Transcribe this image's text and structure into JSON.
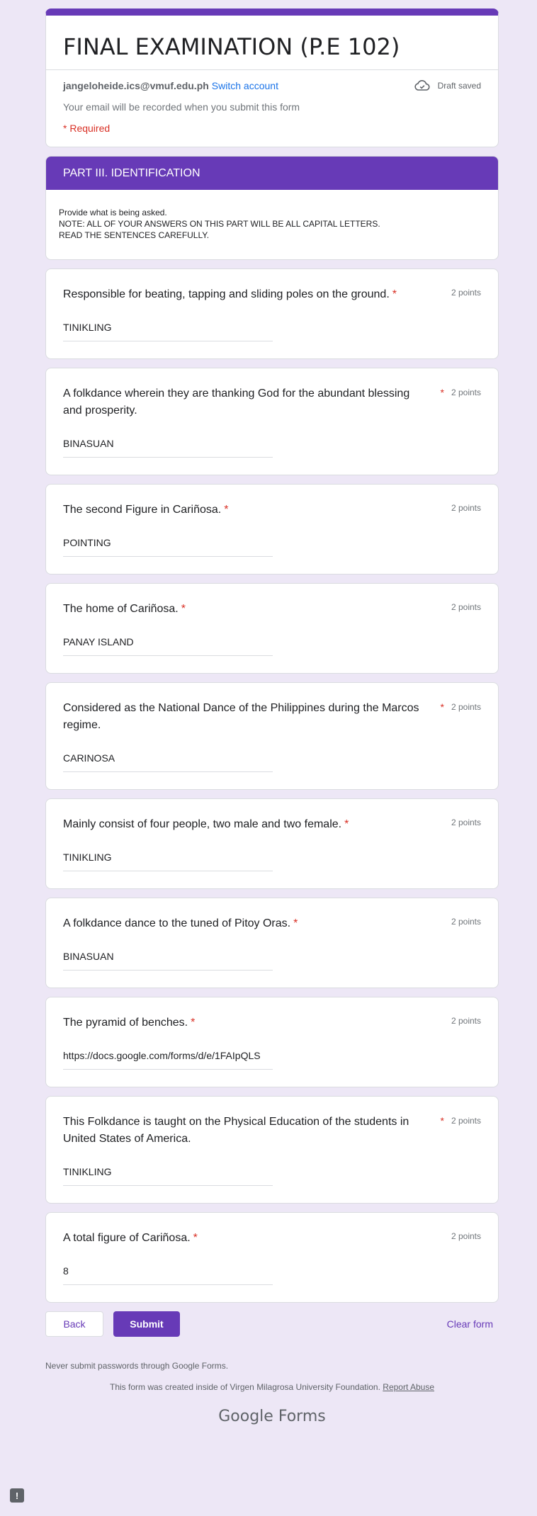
{
  "header": {
    "form_title": "FINAL EXAMINATION (P.E 102)",
    "email": "jangeloheide.ics@vmuf.edu.ph",
    "switch_account": "Switch account",
    "draft_status": "Draft saved",
    "email_note": "Your email will be recorded when you submit this form",
    "required_note": "* Required"
  },
  "section": {
    "title": "PART III. IDENTIFICATION",
    "description": "Provide what is being asked.\nNOTE: ALL OF YOUR ANSWERS ON THIS PART WILL BE ALL CAPITAL LETTERS.\nREAD THE SENTENCES CAREFULLY."
  },
  "questions": [
    {
      "title": "Responsible for beating, tapping and sliding poles on the ground.",
      "points": "2 points",
      "answer": "TINIKLING"
    },
    {
      "title": "A folkdance wherein they are thanking God for the abundant blessing and prosperity.",
      "points": "2 points",
      "answer": "BINASUAN"
    },
    {
      "title": "The second Figure in Cariñosa.",
      "points": "2 points",
      "answer": "POINTING"
    },
    {
      "title": "The home of Cariñosa.",
      "points": "2 points",
      "answer": "PANAY ISLAND"
    },
    {
      "title": "Considered as the National Dance of the Philippines during the Marcos regime.",
      "points": "2 points",
      "answer": "CARINOSA"
    },
    {
      "title": "Mainly consist of four people, two male and two female.",
      "points": "2 points",
      "answer": "TINIKLING"
    },
    {
      "title": "A folkdance dance to the tuned of Pitoy Oras.",
      "points": "2 points",
      "answer": "BINASUAN"
    },
    {
      "title": "The pyramid of benches.",
      "points": "2 points",
      "answer": "https://docs.google.com/forms/d/e/1FAIpQLS"
    },
    {
      "title": "This Folkdance is taught on the Physical Education of the students in United States of America.",
      "points": "2 points",
      "answer": "TINIKLING"
    },
    {
      "title": "A total figure of Cariñosa.",
      "points": "2 points",
      "answer": "8"
    }
  ],
  "required_mark": "*",
  "actions": {
    "back": "Back",
    "submit": "Submit",
    "clear": "Clear form"
  },
  "footer": {
    "never_note": "Never submit passwords through Google Forms.",
    "created_note": "This form was created inside of Virgen Milagrosa University Foundation.",
    "report_abuse": "Report Abuse",
    "brand_google": "Google",
    "brand_forms": "Forms",
    "feedback_glyph": "!"
  },
  "colors": {
    "accent": "#673ab7",
    "background": "#ede7f6",
    "required": "#d93025",
    "link": "#1a73e8"
  },
  "icons": {
    "draft": "cloud-done-icon",
    "feedback": "feedback-icon"
  }
}
